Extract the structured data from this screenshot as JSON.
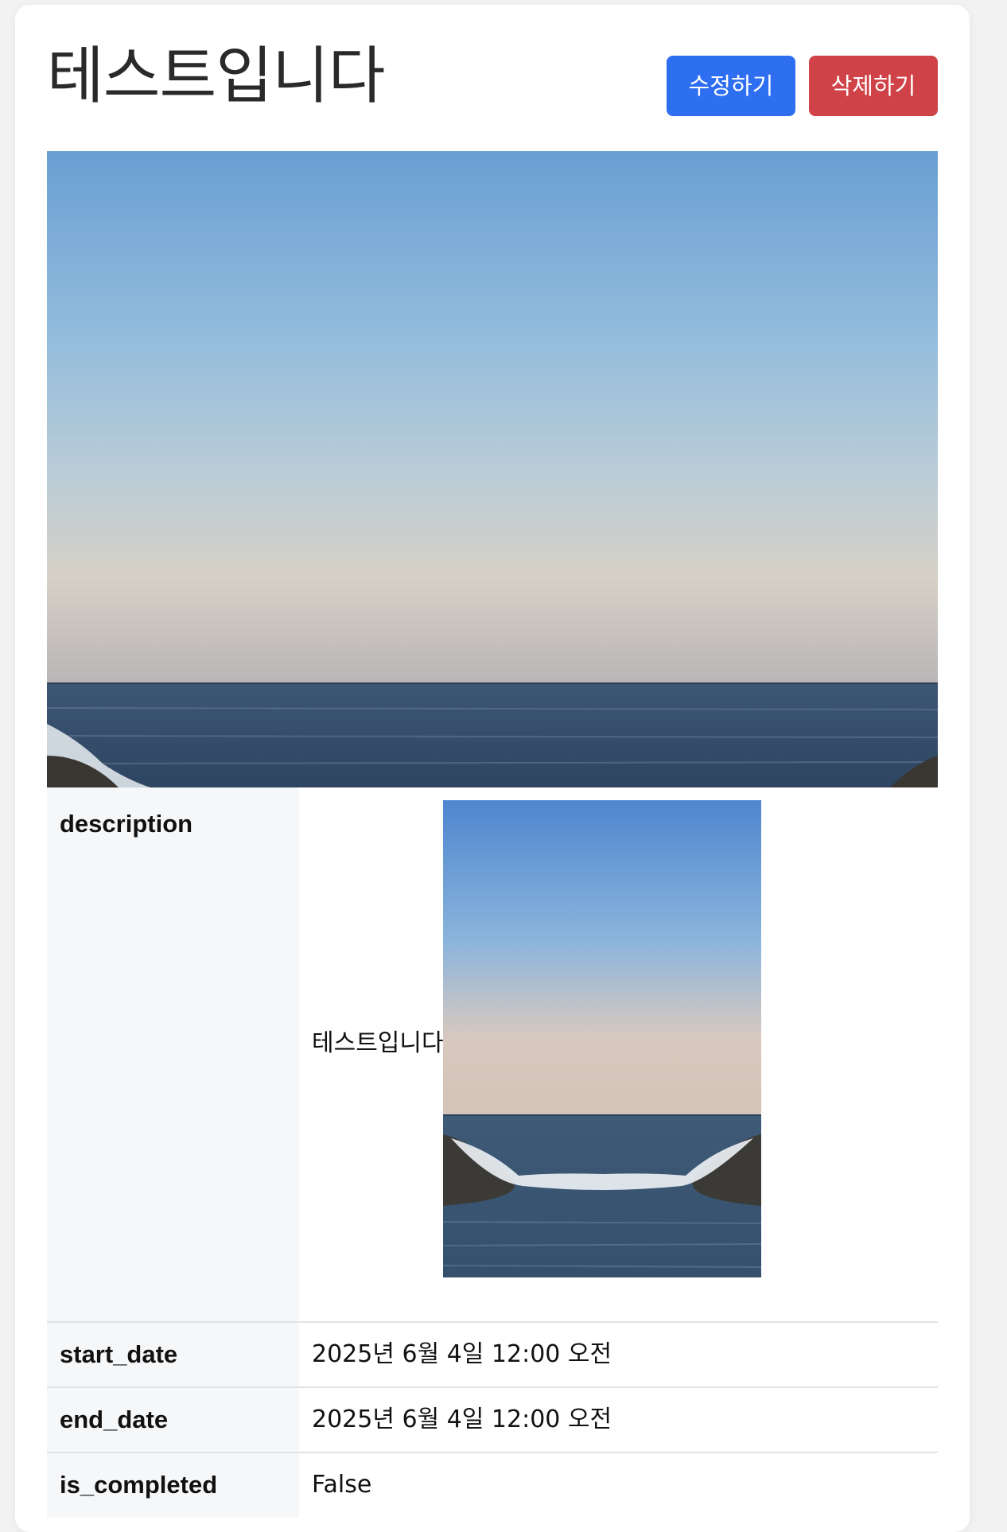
{
  "page": {
    "title": "테스트입니다",
    "edit_button": "수정하기",
    "delete_button": "삭제하기"
  },
  "details": [
    {
      "label": "description",
      "value": "테스트입니다"
    },
    {
      "label": "start_date",
      "value": "2025년 6월 4일 12:00 오전"
    },
    {
      "label": "end_date",
      "value": "2025년 6월 4일 12:00 오전"
    },
    {
      "label": "is_completed",
      "value": "False"
    }
  ],
  "colors": {
    "edit_button": "#2e6ff2",
    "delete_button": "#cf4247",
    "label_background": "#f6f7f9",
    "title_text": "#2a2a2a"
  }
}
